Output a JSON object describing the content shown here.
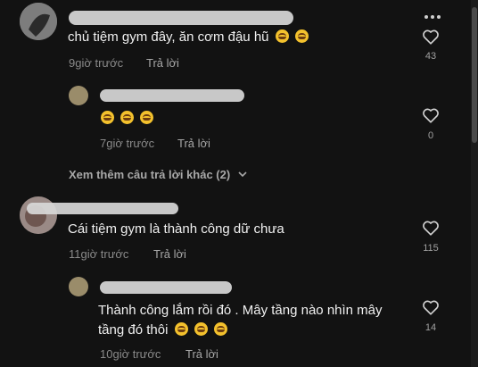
{
  "comments": [
    {
      "text": "chủ tiệm gym đây, ăn cơm đậu hũ",
      "time": "9giờ trước",
      "reply": "Trả lời",
      "likes": "43",
      "emojis": [
        "grin-tears",
        "grin-tears"
      ]
    },
    {
      "text": "",
      "time": "7giờ trước",
      "reply": "Trả lời",
      "likes": "0",
      "emojis": [
        "grin",
        "grin",
        "grin"
      ]
    },
    {
      "text": "Cái tiệm gym là thành công dữ chưa",
      "time": "11giờ trước",
      "reply": "Trả lời",
      "likes": "115"
    },
    {
      "text_line1": "Thành công lắm rồi đó . Mây tầng nào nhìn mây",
      "text_line2": "tầng đó thôi",
      "time": "10giờ trước",
      "reply": "Trả lời",
      "likes": "14",
      "emojis": [
        "grin",
        "grin",
        "grin"
      ]
    }
  ],
  "more_replies": "Xem thêm câu trả lời khác (2)",
  "icons": {
    "more": "more-dots-icon",
    "like": "heart-outline-icon",
    "expand": "chevron-down-icon"
  },
  "colors": {
    "background": "#121212",
    "text": "#f1f1f1",
    "meta": "#8a8a8a",
    "username_accent": "#fe2c55"
  }
}
